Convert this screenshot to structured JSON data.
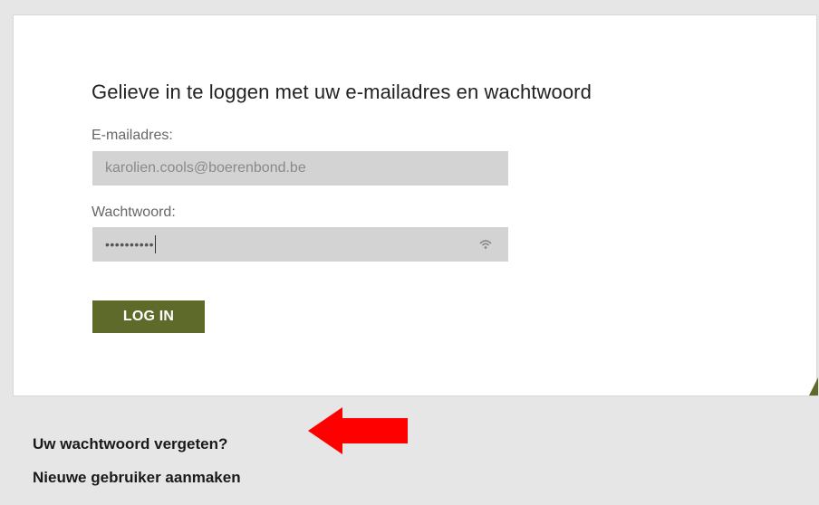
{
  "login": {
    "heading": "Gelieve in te loggen met uw e-mailadres en wachtwoord",
    "email_label": "E-mailadres:",
    "email_value": "karolien.cools@boerenbond.be",
    "password_label": "Wachtwoord:",
    "password_masked": "••••••••••",
    "reveal_icon": "reveal-password-icon",
    "submit_label": "LOG IN"
  },
  "links": {
    "forgot_password": "Uw wachtwoord vergeten?",
    "create_user": "Nieuwe gebruiker aanmaken"
  },
  "annotation": {
    "arrow_icon": "red-arrow-left-icon",
    "arrow_color": "#ff0000"
  },
  "colors": {
    "accent": "#5d6a2a",
    "field_background": "#d3d3d3",
    "page_background": "#e6e6e6"
  }
}
